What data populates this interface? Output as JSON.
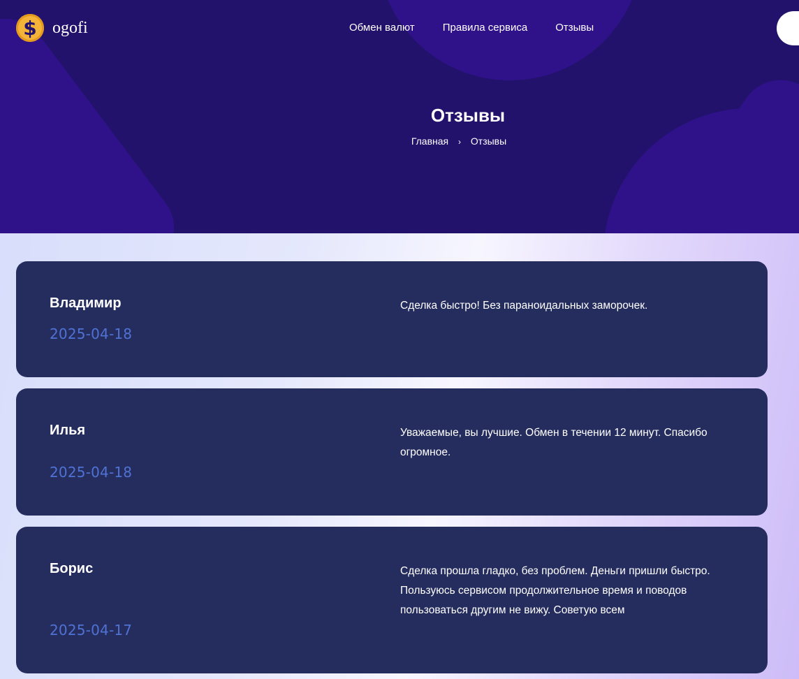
{
  "brand": {
    "logo_symbol": "$",
    "name": "ogofi"
  },
  "nav": {
    "items": [
      "Обмен валют",
      "Правила сервиса",
      "Отзывы"
    ]
  },
  "hero": {
    "title": "Отзывы",
    "breadcrumb": {
      "home": "Главная",
      "separator": "›",
      "current": "Отзывы"
    }
  },
  "reviews": [
    {
      "name": "Владимир",
      "date": "2025-04-18",
      "text": "Сделка быстро! Без параноидальных заморочек."
    },
    {
      "name": "Илья",
      "date": "2025-04-18",
      "text": "Уважаемые, вы лучшие. Обмен в течении 12 минут. Спасибо огромное."
    },
    {
      "name": "Борис",
      "date": "2025-04-17",
      "text": "Сделка прошла гладко, без проблем. Деньги пришли быстро. Пользуюсь сервисом продолжительное время и поводов пользоваться другим не вижу. Советую всем"
    }
  ],
  "colors": {
    "hero_bg": "#22126b",
    "hero_shape": "#2f128a",
    "card_bg": "#252d5e",
    "date_color": "#4f72d4",
    "coin": "#f4b43a"
  }
}
